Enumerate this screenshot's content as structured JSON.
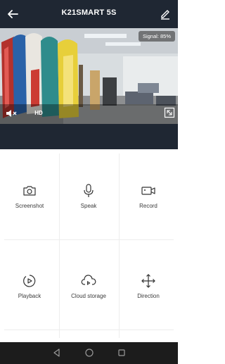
{
  "header": {
    "title": "K21SMART 5S",
    "back_icon": "back-arrow-icon",
    "edit_icon": "edit-pencil-icon"
  },
  "video": {
    "signal_text": "Signal: 85%",
    "hd_label": "HD",
    "mute_icon": "speaker-mute-icon",
    "fullscreen_icon": "fullscreen-icon"
  },
  "controls": [
    {
      "label": "Screenshot",
      "icon": "camera-icon"
    },
    {
      "label": "Speak",
      "icon": "microphone-icon"
    },
    {
      "label": "Record",
      "icon": "video-record-icon"
    },
    {
      "label": "Playback",
      "icon": "playback-icon"
    },
    {
      "label": "Cloud storage",
      "icon": "cloud-storage-icon"
    },
    {
      "label": "Direction",
      "icon": "direction-arrows-icon"
    }
  ],
  "navbar": {
    "back_icon": "nav-back-icon",
    "home_icon": "nav-home-icon",
    "recents_icon": "nav-recents-icon"
  },
  "colors": {
    "header_bg": "#1f2733",
    "navbar_bg": "#1c1c1c",
    "grid_line": "#ededed",
    "label_text": "#3a3a3a"
  }
}
